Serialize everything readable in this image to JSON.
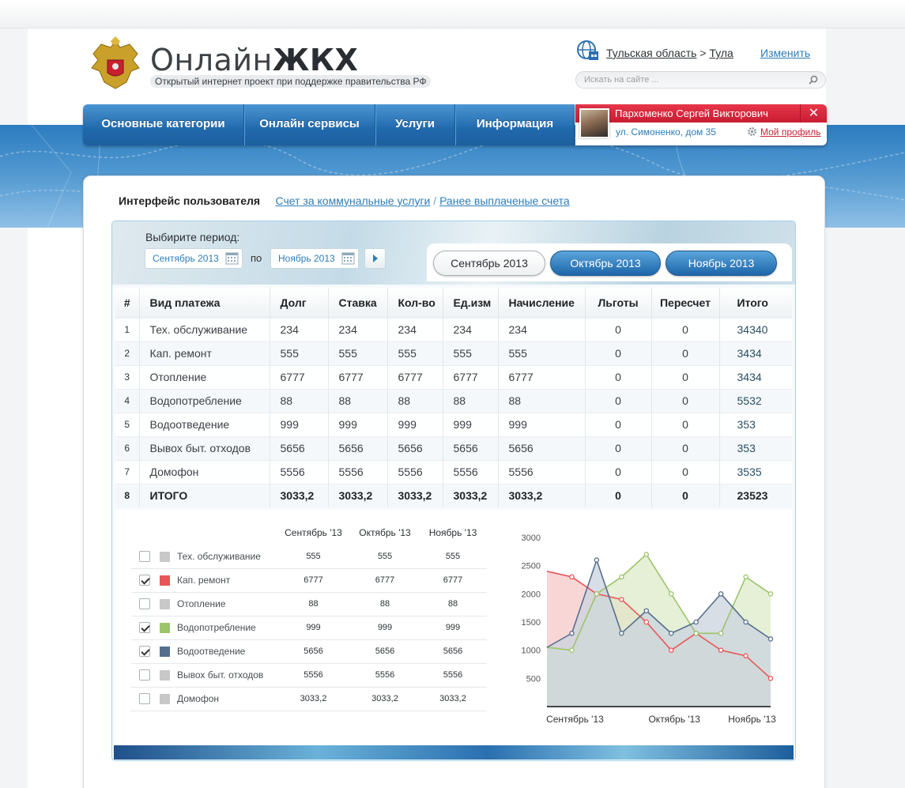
{
  "header": {
    "logo_regular": "Онлайн",
    "logo_bold": "ЖКХ",
    "tagline": "Открытый интернет проект при поддержке правительства РФ",
    "region": "Тульская область",
    "region_sep": ">",
    "city": "Тула",
    "change_link": "Изменить",
    "search_placeholder": "Искать на сайте ..."
  },
  "nav": {
    "items": [
      {
        "label": "Основные категории"
      },
      {
        "label": "Онлайн сервисы"
      },
      {
        "label": "Услуги"
      },
      {
        "label": "Информация"
      }
    ]
  },
  "user": {
    "name": "Пархоменко Сергей Викторович",
    "address": "ул. Симоненко, дом 35",
    "profile_link": "Мой профиль",
    "close_symbol": "✕"
  },
  "breadcrumb": {
    "current": "Интерфейс пользователя",
    "link1": "Счет за коммунальные услуги",
    "sep": "/",
    "link2": "Ранее выплаченые счета"
  },
  "period": {
    "label": "Выбирите период:",
    "from": "Сентябрь 2013",
    "to_word": "по",
    "to": "Ноябрь 2013"
  },
  "month_tabs": [
    {
      "label": "Сентябрь 2013",
      "active": false
    },
    {
      "label": "Октябрь 2013",
      "active": true
    },
    {
      "label": "Ноябрь 2013",
      "active": true
    }
  ],
  "table": {
    "headers": [
      "#",
      "Вид платежа",
      "Долг",
      "Ставка",
      "Кол-во",
      "Ед.изм",
      "Начисление",
      "Льготы",
      "Пересчет",
      "Итого"
    ],
    "rows": [
      [
        "1",
        "Тех. обслуживание",
        "234",
        "234",
        "234",
        "234",
        "234",
        "0",
        "0",
        "34340"
      ],
      [
        "2",
        "Кап. ремонт",
        "555",
        "555",
        "555",
        "555",
        "555",
        "0",
        "0",
        "3434"
      ],
      [
        "3",
        "Отопление",
        "6777",
        "6777",
        "6777",
        "6777",
        "6777",
        "0",
        "0",
        "3434"
      ],
      [
        "4",
        "Водопотребление",
        "88",
        "88",
        "88",
        "88",
        "88",
        "0",
        "0",
        "5532"
      ],
      [
        "5",
        "Водоотведение",
        "999",
        "999",
        "999",
        "999",
        "999",
        "0",
        "0",
        "353"
      ],
      [
        "6",
        "Вывох быт. отходов",
        "5656",
        "5656",
        "5656",
        "5656",
        "5656",
        "0",
        "0",
        "353"
      ],
      [
        "7",
        "Домофон",
        "5556",
        "5556",
        "5556",
        "5556",
        "5556",
        "0",
        "0",
        "3535"
      ]
    ],
    "total": [
      "8",
      "ИТОГО",
      "3033,2",
      "3033,2",
      "3033,2",
      "3033,2",
      "3033,2",
      "0",
      "0",
      "23523"
    ]
  },
  "legend_table": {
    "headers": [
      "Сентябрь '13",
      "Октябрь '13",
      "Ноябрь '13"
    ],
    "rows": [
      {
        "label": "Тех. обслуживание",
        "checked": false,
        "color": "#c8c8c8",
        "values": [
          "555",
          "555",
          "555"
        ]
      },
      {
        "label": "Кап. ремонт",
        "checked": true,
        "color": "#e8565a",
        "values": [
          "6777",
          "6777",
          "6777"
        ]
      },
      {
        "label": "Отопление",
        "checked": false,
        "color": "#c8c8c8",
        "values": [
          "88",
          "88",
          "88"
        ]
      },
      {
        "label": "Водопотребление",
        "checked": true,
        "color": "#9cc46a",
        "values": [
          "999",
          "999",
          "999"
        ]
      },
      {
        "label": "Водоотведение",
        "checked": true,
        "color": "#566f8e",
        "values": [
          "5656",
          "5656",
          "5656"
        ]
      },
      {
        "label": "Вывох быт. отходов",
        "checked": false,
        "color": "#c8c8c8",
        "values": [
          "5556",
          "5556",
          "5556"
        ]
      },
      {
        "label": "Домофон",
        "checked": false,
        "color": "#c8c8c8",
        "values": [
          "3033,2",
          "3033,2",
          "3033,2"
        ]
      }
    ]
  },
  "chart_data": {
    "type": "area",
    "title": "",
    "xlabel": "",
    "ylabel": "",
    "ylim": [
      0,
      3000
    ],
    "yticks": [
      500,
      1000,
      1500,
      2000,
      2500,
      3000
    ],
    "x_tick_labels": [
      "Сентябрь '13",
      "Октябрь '13",
      "Ноябрь '13"
    ],
    "x_tick_index": [
      1,
      5,
      8
    ],
    "x": [
      0,
      1,
      2,
      3,
      4,
      5,
      6,
      7,
      8,
      9
    ],
    "grid": false,
    "series": [
      {
        "color": "#e8565a",
        "fill": "#f7c8c8",
        "values": [
          2400,
          2300,
          2000,
          1900,
          1500,
          1000,
          1300,
          1000,
          900,
          500
        ]
      },
      {
        "color": "#9cc46a",
        "fill": "#dcebc8",
        "values": [
          1050,
          1000,
          2000,
          2300,
          2700,
          2000,
          1300,
          1300,
          2300,
          2000
        ]
      },
      {
        "color": "#566f8e",
        "fill": "#c9d3de",
        "values": [
          1050,
          1300,
          2600,
          1300,
          1700,
          1300,
          1500,
          2000,
          1500,
          1200
        ]
      }
    ]
  }
}
